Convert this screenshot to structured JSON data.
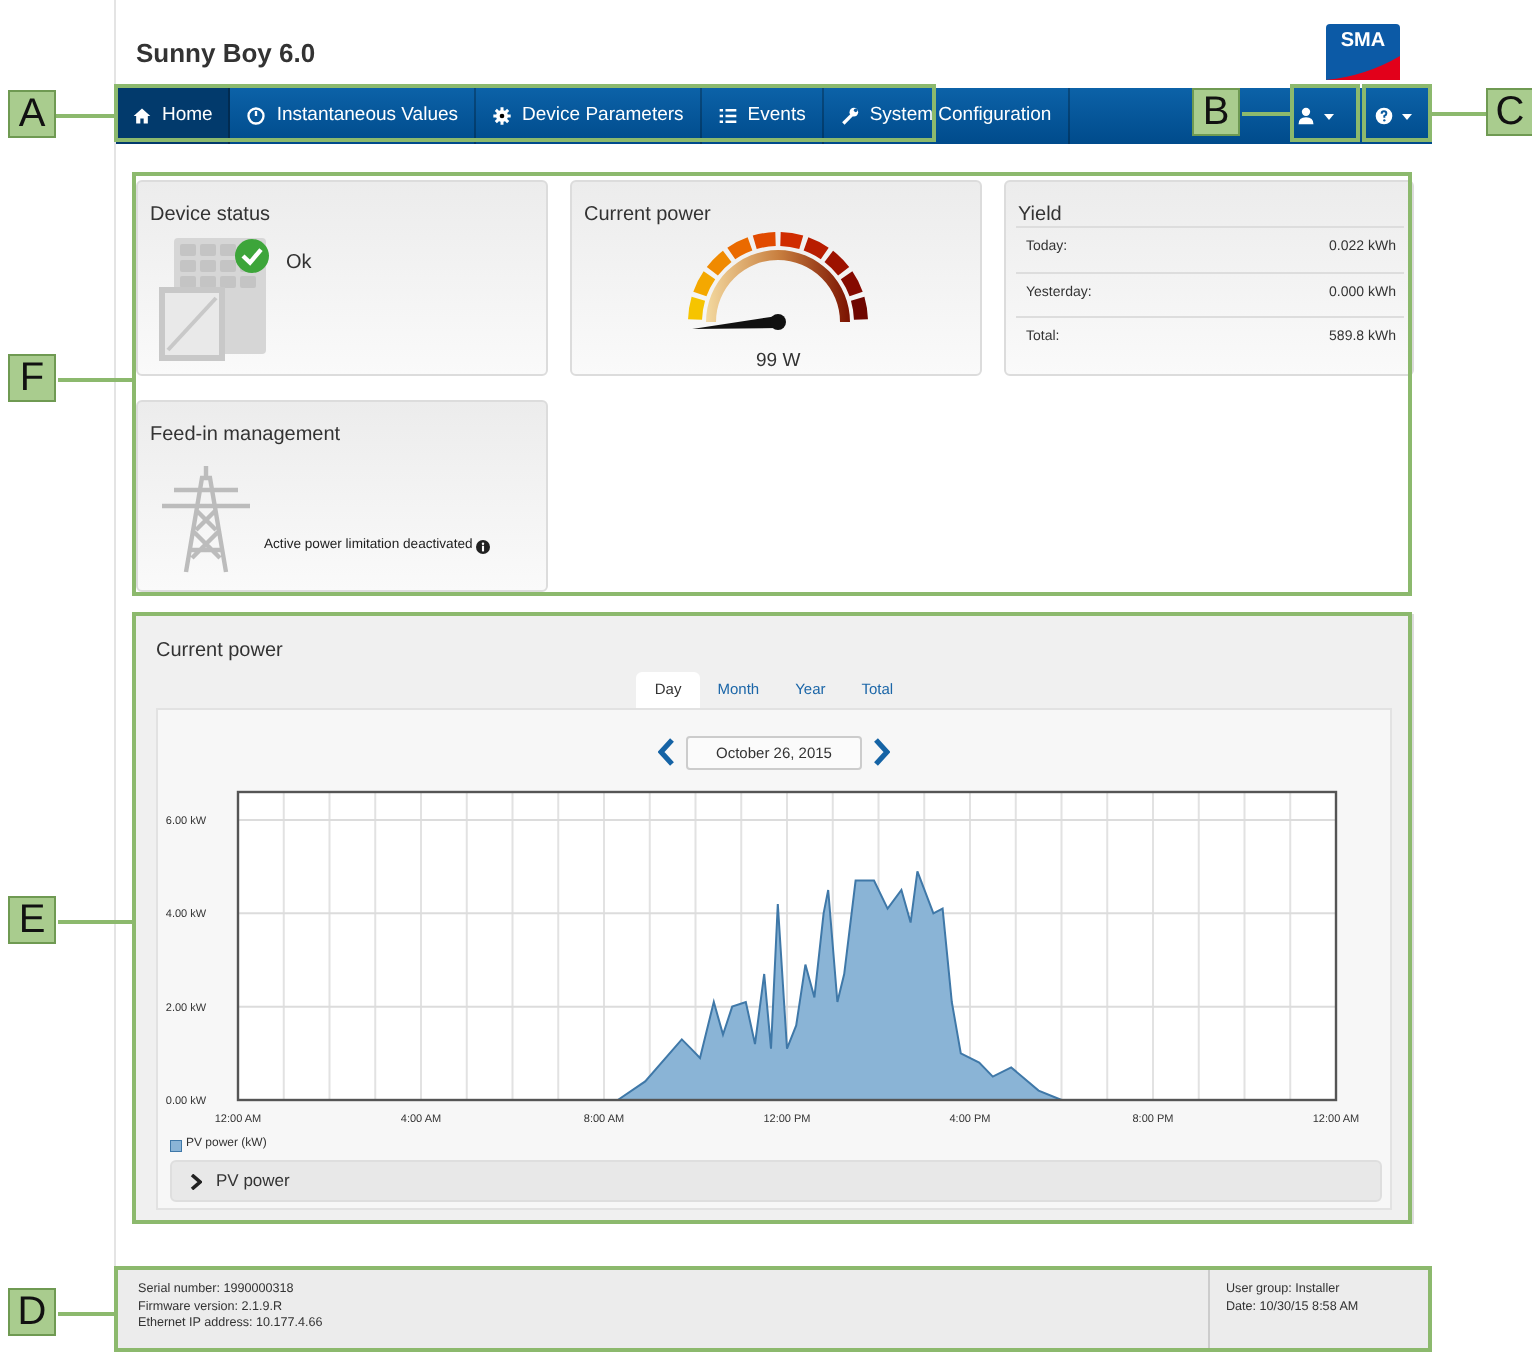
{
  "header": {
    "title": "Sunny Boy 6.0",
    "logo": "SMA"
  },
  "nav": {
    "items": [
      {
        "label": "Home",
        "selected": true
      },
      {
        "label": "Instantaneous Values",
        "selected": false
      },
      {
        "label": "Device Parameters",
        "selected": false
      },
      {
        "label": "Events",
        "selected": false
      },
      {
        "label": "System Configuration",
        "selected": false
      }
    ]
  },
  "dashboard": {
    "cards": [
      {
        "kind": "status",
        "title": "Device status",
        "status": "Ok"
      },
      {
        "kind": "gauge",
        "title": "Current power",
        "reading": "99 W"
      },
      {
        "kind": "yield",
        "title": "Yield",
        "rows": [
          {
            "label": "Today:",
            "value": "0.022 kWh"
          },
          {
            "label": "Yesterday:",
            "value": "0.000 kWh"
          },
          {
            "label": "Total:",
            "value": "589.8 kWh"
          }
        ]
      },
      {
        "kind": "feedin",
        "title": "Feed-in management",
        "text": "Active power limitation deactivated"
      }
    ]
  },
  "chart_panel": {
    "title": "Current power",
    "tabs": [
      {
        "label": "Day",
        "selected": true
      },
      {
        "label": "Month",
        "selected": false
      },
      {
        "label": "Year",
        "selected": false
      },
      {
        "label": "Total",
        "selected": false
      }
    ],
    "date": "October 26, 2015",
    "chart_data": {
      "type": "area",
      "x": [
        8.3,
        8.9,
        9.7,
        9.9,
        10.1,
        10.4,
        10.6,
        10.8,
        11.1,
        11.3,
        11.5,
        11.65,
        11.8,
        12.0,
        12.2,
        12.4,
        12.6,
        12.8,
        12.9,
        13.1,
        13.25,
        13.5,
        13.9,
        14.2,
        14.5,
        14.7,
        14.85,
        15.2,
        15.4,
        15.6,
        15.8,
        16.2,
        16.5,
        16.9,
        17.5,
        18.0
      ],
      "series": [
        {
          "name": "PV power (kW)",
          "color": "#8ab4d6",
          "values": [
            0,
            0.4,
            1.3,
            1.1,
            0.9,
            2.1,
            1.4,
            2.0,
            2.1,
            1.2,
            2.7,
            1.1,
            4.2,
            1.1,
            1.6,
            2.9,
            2.2,
            4.0,
            4.5,
            2.1,
            2.7,
            4.7,
            4.7,
            4.1,
            4.5,
            3.8,
            4.9,
            4.0,
            4.1,
            2.1,
            1.0,
            0.8,
            0.5,
            0.7,
            0.2,
            0
          ]
        }
      ],
      "xlim": [
        0,
        24
      ],
      "ylim": [
        0,
        6.6
      ],
      "grid": true,
      "xticks": [
        {
          "value": 0,
          "label": "12:00 AM"
        },
        {
          "value": 4,
          "label": "4:00 AM"
        },
        {
          "value": 8,
          "label": "8:00 AM"
        },
        {
          "value": 12,
          "label": "12:00 PM"
        },
        {
          "value": 16,
          "label": "4:00 PM"
        },
        {
          "value": 20,
          "label": "8:00 PM"
        },
        {
          "value": 24,
          "label": "12:00 AM"
        }
      ],
      "yticks": [
        {
          "value": 0,
          "label": "0.00 kW"
        },
        {
          "value": 2,
          "label": "2.00 kW"
        },
        {
          "value": 4,
          "label": "4.00 kW"
        },
        {
          "value": 6,
          "label": "6.00 kW"
        }
      ]
    },
    "accordion": {
      "label": "PV power",
      "expanded": false
    }
  },
  "footer": {
    "left": [
      "Serial number: 1990000318",
      "Firmware version: 2.1.9.R",
      "Ethernet IP address: 10.177.4.66"
    ],
    "right": [
      "User group: Installer",
      "Date: 10/30/15 8:58 AM"
    ]
  },
  "callouts": [
    {
      "label": "A"
    },
    {
      "label": "B"
    },
    {
      "label": "C"
    },
    {
      "label": "F"
    },
    {
      "label": "E"
    },
    {
      "label": "D"
    }
  ]
}
